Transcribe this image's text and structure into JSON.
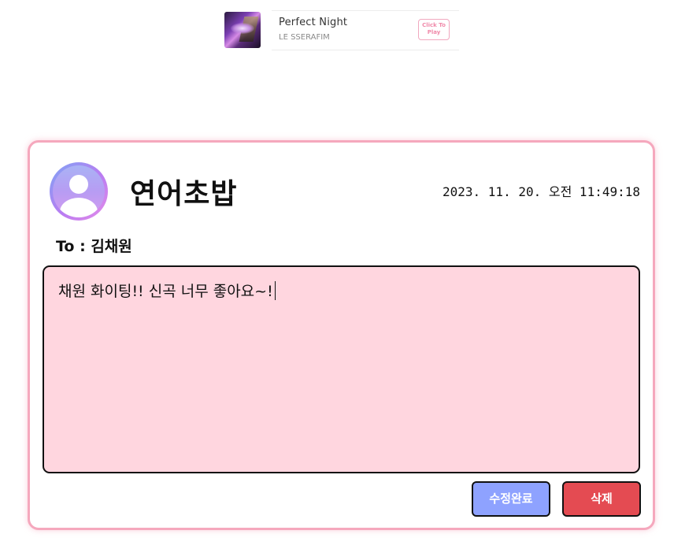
{
  "player": {
    "track_title": "Perfect Night",
    "artist": "LE SSERAFIM",
    "play_button_label": "Click To Play",
    "cover_icon": "album-cover-image"
  },
  "message": {
    "author": "연어초밥",
    "date": "2023. 11. 20. 오전 11:49:18",
    "to_label": "To : 김채원",
    "body": "채원 화이팅!! 신곡 너무 좋아요~!",
    "avatar_icon": "user-avatar-icon"
  },
  "actions": {
    "save_label": "수정완료",
    "delete_label": "삭제"
  },
  "colors": {
    "card_border": "#f5a8bd",
    "message_background": "#ffd6df",
    "save_button": "#8ea2ff",
    "delete_button": "#e44b52"
  }
}
